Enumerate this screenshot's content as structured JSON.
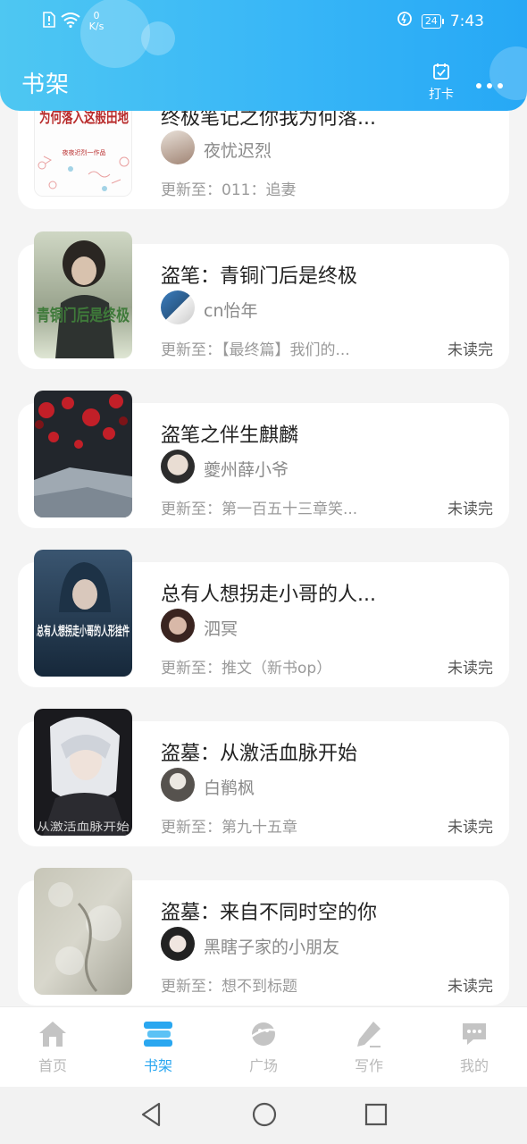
{
  "status_bar": {
    "net_speed_value": "0",
    "net_speed_unit": "K/s",
    "battery": "24",
    "time": "7:43"
  },
  "header": {
    "title": "书架",
    "checkin_label": "打卡"
  },
  "books": [
    {
      "title": "终极笔记之你我为何落...",
      "author": "夜忧迟烈",
      "update": "更新至：011：追妻",
      "status": "",
      "cover_text": "为何落入这般田地",
      "cover_sub": "夜夜迟烈一作品"
    },
    {
      "title": "盗笔：青铜门后是终极",
      "author": "cn怡年",
      "update": "更新至：【最终篇】我们的...",
      "status": "未读完",
      "cover_text": "青铜门后是终极"
    },
    {
      "title": "盗笔之伴生麒麟",
      "author": "夔州薛小爷",
      "update": "更新至：第一百五十三章笑...",
      "status": "未读完"
    },
    {
      "title": "总有人想拐走小哥的人...",
      "author": "泗冥",
      "update": "更新至：推文（新书op）",
      "status": "未读完",
      "cover_text": "总有人想拐走小哥的人形挂件"
    },
    {
      "title": "盗墓：从激活血脉开始",
      "author": "白鹡枫",
      "update": "更新至：第九十五章",
      "status": "未读完",
      "cover_text": "从激活血脉开始"
    },
    {
      "title": "盗墓：来自不同时空的你",
      "author": "黑瞎子家的小朋友",
      "update": "更新至：想不到标题",
      "status": "未读完"
    }
  ],
  "bottom_nav": [
    {
      "label": "首页",
      "icon": "home-icon",
      "active": false
    },
    {
      "label": "书架",
      "icon": "bookshelf-icon",
      "active": true
    },
    {
      "label": "广场",
      "icon": "planet-icon",
      "active": false
    },
    {
      "label": "写作",
      "icon": "pen-icon",
      "active": false
    },
    {
      "label": "我的",
      "icon": "chat-icon",
      "active": false
    }
  ],
  "colors": {
    "accent": "#2aa7f0",
    "header_start": "#4ec7f2",
    "header_end": "#26a8f5",
    "inactive": "#c4c4c4"
  }
}
